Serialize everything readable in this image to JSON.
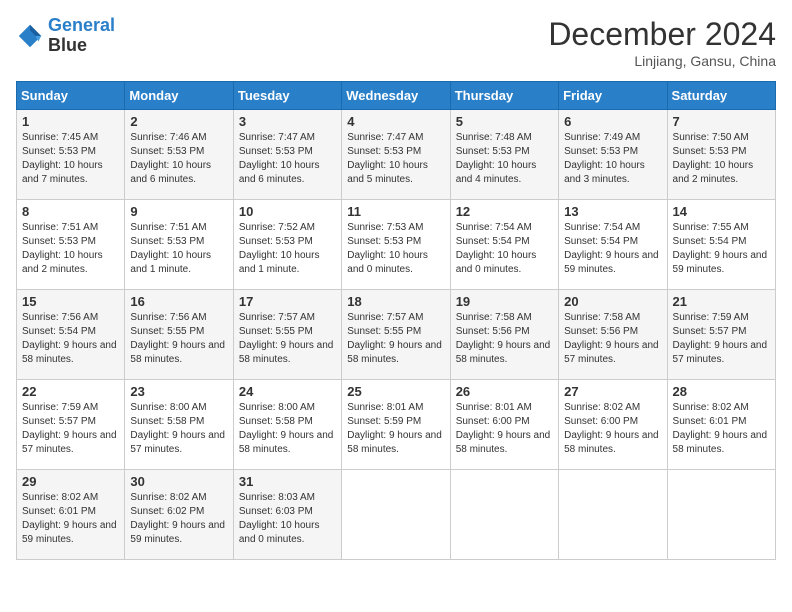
{
  "logo": {
    "line1": "General",
    "line2": "Blue"
  },
  "title": "December 2024",
  "subtitle": "Linjiang, Gansu, China",
  "days_header": [
    "Sunday",
    "Monday",
    "Tuesday",
    "Wednesday",
    "Thursday",
    "Friday",
    "Saturday"
  ],
  "weeks": [
    [
      {
        "day": "1",
        "sunrise": "7:45 AM",
        "sunset": "5:53 PM",
        "daylight": "10 hours and 7 minutes."
      },
      {
        "day": "2",
        "sunrise": "7:46 AM",
        "sunset": "5:53 PM",
        "daylight": "10 hours and 6 minutes."
      },
      {
        "day": "3",
        "sunrise": "7:47 AM",
        "sunset": "5:53 PM",
        "daylight": "10 hours and 6 minutes."
      },
      {
        "day": "4",
        "sunrise": "7:47 AM",
        "sunset": "5:53 PM",
        "daylight": "10 hours and 5 minutes."
      },
      {
        "day": "5",
        "sunrise": "7:48 AM",
        "sunset": "5:53 PM",
        "daylight": "10 hours and 4 minutes."
      },
      {
        "day": "6",
        "sunrise": "7:49 AM",
        "sunset": "5:53 PM",
        "daylight": "10 hours and 3 minutes."
      },
      {
        "day": "7",
        "sunrise": "7:50 AM",
        "sunset": "5:53 PM",
        "daylight": "10 hours and 2 minutes."
      }
    ],
    [
      {
        "day": "8",
        "sunrise": "7:51 AM",
        "sunset": "5:53 PM",
        "daylight": "10 hours and 2 minutes."
      },
      {
        "day": "9",
        "sunrise": "7:51 AM",
        "sunset": "5:53 PM",
        "daylight": "10 hours and 1 minute."
      },
      {
        "day": "10",
        "sunrise": "7:52 AM",
        "sunset": "5:53 PM",
        "daylight": "10 hours and 1 minute."
      },
      {
        "day": "11",
        "sunrise": "7:53 AM",
        "sunset": "5:53 PM",
        "daylight": "10 hours and 0 minutes."
      },
      {
        "day": "12",
        "sunrise": "7:54 AM",
        "sunset": "5:54 PM",
        "daylight": "10 hours and 0 minutes."
      },
      {
        "day": "13",
        "sunrise": "7:54 AM",
        "sunset": "5:54 PM",
        "daylight": "9 hours and 59 minutes."
      },
      {
        "day": "14",
        "sunrise": "7:55 AM",
        "sunset": "5:54 PM",
        "daylight": "9 hours and 59 minutes."
      }
    ],
    [
      {
        "day": "15",
        "sunrise": "7:56 AM",
        "sunset": "5:54 PM",
        "daylight": "9 hours and 58 minutes."
      },
      {
        "day": "16",
        "sunrise": "7:56 AM",
        "sunset": "5:55 PM",
        "daylight": "9 hours and 58 minutes."
      },
      {
        "day": "17",
        "sunrise": "7:57 AM",
        "sunset": "5:55 PM",
        "daylight": "9 hours and 58 minutes."
      },
      {
        "day": "18",
        "sunrise": "7:57 AM",
        "sunset": "5:55 PM",
        "daylight": "9 hours and 58 minutes."
      },
      {
        "day": "19",
        "sunrise": "7:58 AM",
        "sunset": "5:56 PM",
        "daylight": "9 hours and 58 minutes."
      },
      {
        "day": "20",
        "sunrise": "7:58 AM",
        "sunset": "5:56 PM",
        "daylight": "9 hours and 57 minutes."
      },
      {
        "day": "21",
        "sunrise": "7:59 AM",
        "sunset": "5:57 PM",
        "daylight": "9 hours and 57 minutes."
      }
    ],
    [
      {
        "day": "22",
        "sunrise": "7:59 AM",
        "sunset": "5:57 PM",
        "daylight": "9 hours and 57 minutes."
      },
      {
        "day": "23",
        "sunrise": "8:00 AM",
        "sunset": "5:58 PM",
        "daylight": "9 hours and 57 minutes."
      },
      {
        "day": "24",
        "sunrise": "8:00 AM",
        "sunset": "5:58 PM",
        "daylight": "9 hours and 58 minutes."
      },
      {
        "day": "25",
        "sunrise": "8:01 AM",
        "sunset": "5:59 PM",
        "daylight": "9 hours and 58 minutes."
      },
      {
        "day": "26",
        "sunrise": "8:01 AM",
        "sunset": "6:00 PM",
        "daylight": "9 hours and 58 minutes."
      },
      {
        "day": "27",
        "sunrise": "8:02 AM",
        "sunset": "6:00 PM",
        "daylight": "9 hours and 58 minutes."
      },
      {
        "day": "28",
        "sunrise": "8:02 AM",
        "sunset": "6:01 PM",
        "daylight": "9 hours and 58 minutes."
      }
    ],
    [
      {
        "day": "29",
        "sunrise": "8:02 AM",
        "sunset": "6:01 PM",
        "daylight": "9 hours and 59 minutes."
      },
      {
        "day": "30",
        "sunrise": "8:02 AM",
        "sunset": "6:02 PM",
        "daylight": "9 hours and 59 minutes."
      },
      {
        "day": "31",
        "sunrise": "8:03 AM",
        "sunset": "6:03 PM",
        "daylight": "10 hours and 0 minutes."
      },
      null,
      null,
      null,
      null
    ]
  ]
}
